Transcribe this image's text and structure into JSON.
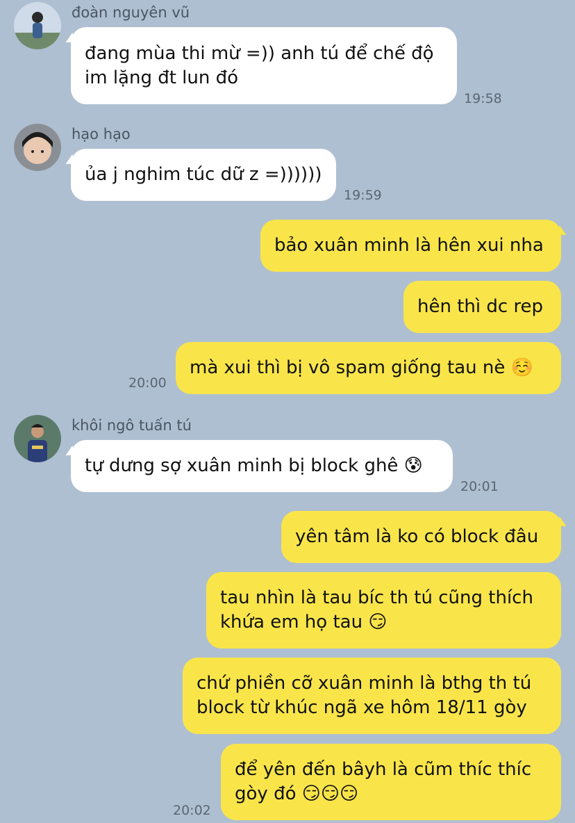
{
  "colors": {
    "background": "#aebfd1",
    "incoming_bubble": "#ffffff",
    "outgoing_bubble": "#f9e54a",
    "timestamp": "#5b6672"
  },
  "messages": [
    {
      "sender": "đoàn nguyên vũ",
      "avatar": "avatar-vu",
      "text": "đang mùa thi mừ =)) anh tú để chế độ\nim lặng đt lun đó",
      "time": "19:58",
      "direction": "incoming"
    },
    {
      "sender": "hạo hạo",
      "avatar": "avatar-hao",
      "text": "ủa j nghim túc dữ z =))))))",
      "time": "19:59",
      "direction": "incoming"
    },
    {
      "text": "bảo xuân minh là hên xui nha",
      "direction": "outgoing"
    },
    {
      "text": "hên thì dc rep",
      "direction": "outgoing"
    },
    {
      "text": "mà xui thì bị vô spam giống tau nè ☺️",
      "time": "20:00",
      "direction": "outgoing"
    },
    {
      "sender": "khôi ngô tuấn tú",
      "avatar": "avatar-tu",
      "text": "tự dưng sợ xuân minh bị block ghê 😰",
      "time": "20:01",
      "direction": "incoming"
    },
    {
      "text": "yên tâm là ko có block đâu",
      "direction": "outgoing"
    },
    {
      "text": "tau nhìn là tau bíc th tú cũng thích\nkhứa em họ tau 😏",
      "direction": "outgoing"
    },
    {
      "text": "chứ phiền cỡ xuân minh là bthg th tú\nblock từ khúc ngã xe hôm 18/11 gòy",
      "direction": "outgoing"
    },
    {
      "text": "để yên đến bâyh là cũm thíc thíc\ngòy đó 😏😏😏",
      "time": "20:02",
      "direction": "outgoing"
    }
  ]
}
